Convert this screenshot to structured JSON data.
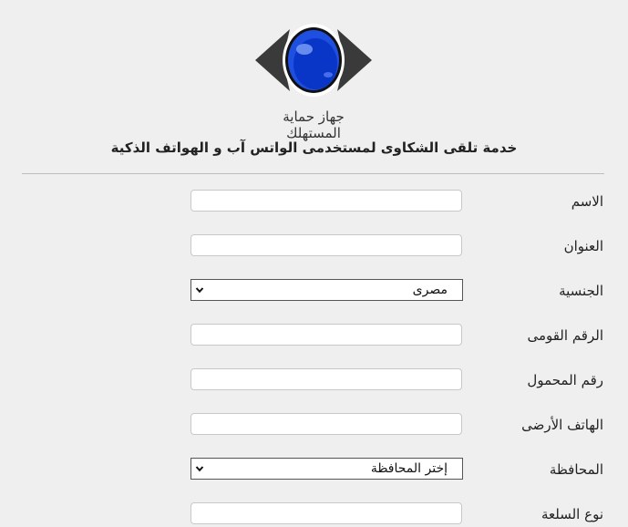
{
  "header": {
    "logo_text": "جهاز حماية المستهلك",
    "service_title": "خدمة تلقى الشكاوى لمستخدمى الواتس آب و الهواتف الذكية"
  },
  "colors": {
    "eye_blue": "#1f4fe0",
    "eye_dark": "#333333",
    "background": "#efefef"
  },
  "form": {
    "name": {
      "label": "الاسم",
      "value": ""
    },
    "address": {
      "label": "العنوان",
      "value": ""
    },
    "nationality": {
      "label": "الجنسية",
      "selected": "مصرى"
    },
    "national_id": {
      "label": "الرقم القومى",
      "value": ""
    },
    "mobile": {
      "label": "رقم المحمول",
      "value": ""
    },
    "landline": {
      "label": "الهاتف الأرضى",
      "value": ""
    },
    "governorate": {
      "label": "المحافظة",
      "selected": "إختر المحافظة"
    },
    "product_type": {
      "label": "نوع السلعة",
      "value": ""
    }
  },
  "icons": {
    "logo": "eye-logo-icon",
    "dropdown": "chevron-down-icon"
  }
}
